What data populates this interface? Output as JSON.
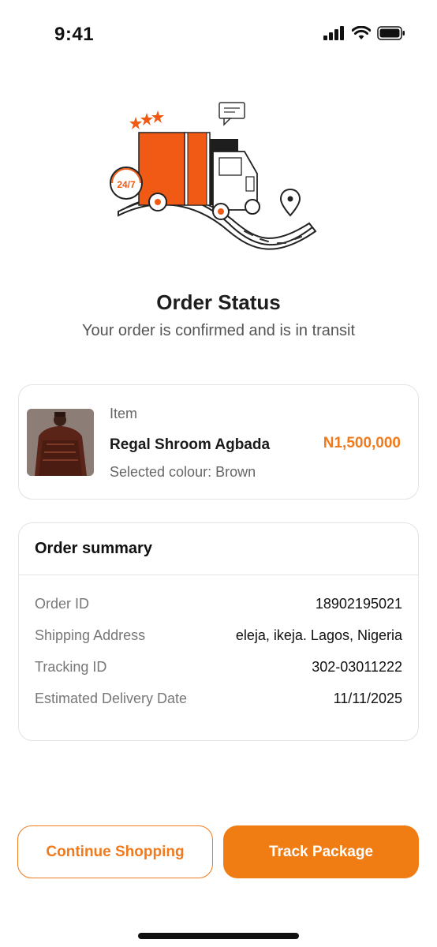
{
  "status_bar": {
    "time": "9:41",
    "icons": [
      "cellular-signal-icon",
      "wifi-icon",
      "battery-icon"
    ]
  },
  "hero": {
    "illustration": "delivery-truck-illustration",
    "badge_text": "24/7"
  },
  "header": {
    "title": "Order Status",
    "subtitle": "Your order is confirmed and is in transit"
  },
  "item": {
    "label": "Item",
    "name": "Regal Shroom Agbada",
    "price": "N1,500,000",
    "colour": "Selected colour: Brown"
  },
  "summary": {
    "title": "Order summary",
    "rows": [
      {
        "label": "Order ID",
        "value": "18902195021"
      },
      {
        "label": "Shipping Address",
        "value": "eleja, ikeja. Lagos, Nigeria"
      },
      {
        "label": "Tracking ID",
        "value": "302-03011222"
      },
      {
        "label": "Estimated Delivery Date",
        "value": "11/11/2025"
      }
    ]
  },
  "actions": {
    "continue_label": "Continue Shopping",
    "track_label": "Track Package"
  },
  "colors": {
    "accent": "#f07a1c",
    "text": "#1c1c1c",
    "muted": "#777777",
    "border": "#e3e3e3"
  }
}
